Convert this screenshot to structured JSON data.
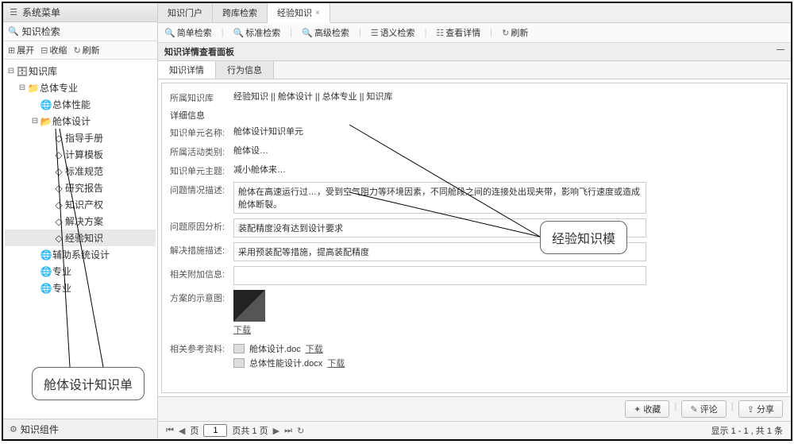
{
  "sidebar": {
    "title": "系统菜单",
    "search_placeholder": "知识检索",
    "toolbar": {
      "expand": "展开",
      "collapse": "收缩",
      "refresh": "刷新"
    },
    "tree": {
      "root": "知识库",
      "nodes": [
        {
          "label": "总体专业",
          "level": 1,
          "icon": "folder"
        },
        {
          "label": "总体性能",
          "level": 2,
          "icon": "globe"
        },
        {
          "label": "舱体设计",
          "level": 2,
          "icon": "folder-open"
        },
        {
          "label": "指导手册",
          "level": 3,
          "icon": "doc"
        },
        {
          "label": "计算模板",
          "level": 3,
          "icon": "doc"
        },
        {
          "label": "标准规范",
          "level": 3,
          "icon": "doc"
        },
        {
          "label": "研究报告",
          "level": 3,
          "icon": "doc"
        },
        {
          "label": "知识产权",
          "level": 3,
          "icon": "doc"
        },
        {
          "label": "解决方案",
          "level": 3,
          "icon": "doc"
        },
        {
          "label": "经验知识",
          "level": 3,
          "icon": "doc",
          "selected": true
        },
        {
          "label": "辅助系统设计",
          "level": 2,
          "icon": "globe"
        },
        {
          "label": "专业",
          "level": 2,
          "icon": "globe"
        },
        {
          "label": "专业",
          "level": 2,
          "icon": "globe"
        }
      ]
    },
    "footer": "知识组件"
  },
  "tabs": [
    {
      "label": "知识门户",
      "active": false
    },
    {
      "label": "跨库检索",
      "active": false
    },
    {
      "label": "经验知识",
      "active": true,
      "closable": true
    }
  ],
  "search_toolbar": {
    "simple": "简单检索",
    "standard": "标准检索",
    "advanced": "高级检索",
    "semantic": "语义检索",
    "view_detail": "查看详情",
    "refresh": "刷新"
  },
  "panel": {
    "title": "知识详情查看面板",
    "sub_tabs": [
      {
        "label": "知识详情",
        "active": true
      },
      {
        "label": "行为信息",
        "active": false
      }
    ]
  },
  "detail": {
    "kb_label": "所属知识库",
    "kb_value": "经验知识 || 舱体设计 || 总体专业 || 知识库",
    "detail_title": "详细信息",
    "unit_name_label": "知识单元名称:",
    "unit_name_value": "舱体设计知识单元",
    "activity_label": "所属活动类别:",
    "activity_value": "舱体设…",
    "topic_label": "知识单元主题:",
    "topic_value": "减小舱体来…",
    "problem_label": "问题情况描述:",
    "problem_value": "舱体在高速运行过…，受到空气阻力等环境因素，不同舱段之间的连接处出现夹带，影响飞行速度或造成舱体断裂。",
    "cause_label": "问题原因分析:",
    "cause_value": "装配精度没有达到设计要求",
    "solution_label": "解决措施描述:",
    "solution_value": "采用预装配等措施，提高装配精度",
    "attach_label": "相关附加信息:",
    "diagram_label": "方案的示意图:",
    "download": "下载",
    "refs_label": "相关参考资料:",
    "refs": [
      {
        "name": "舱体设计.doc",
        "link": "下载"
      },
      {
        "name": "总体性能设计.docx",
        "link": "下载"
      }
    ]
  },
  "actions": {
    "favorite": "收藏",
    "comment": "评论",
    "share": "分享"
  },
  "pager": {
    "page_label_pre": "页",
    "page_value": "1",
    "page_label_post": "页共 1 页",
    "status": "显示 1 - 1 , 共 1 条"
  },
  "callouts": {
    "left": "舱体设计知识单",
    "right": "经验知识模"
  }
}
